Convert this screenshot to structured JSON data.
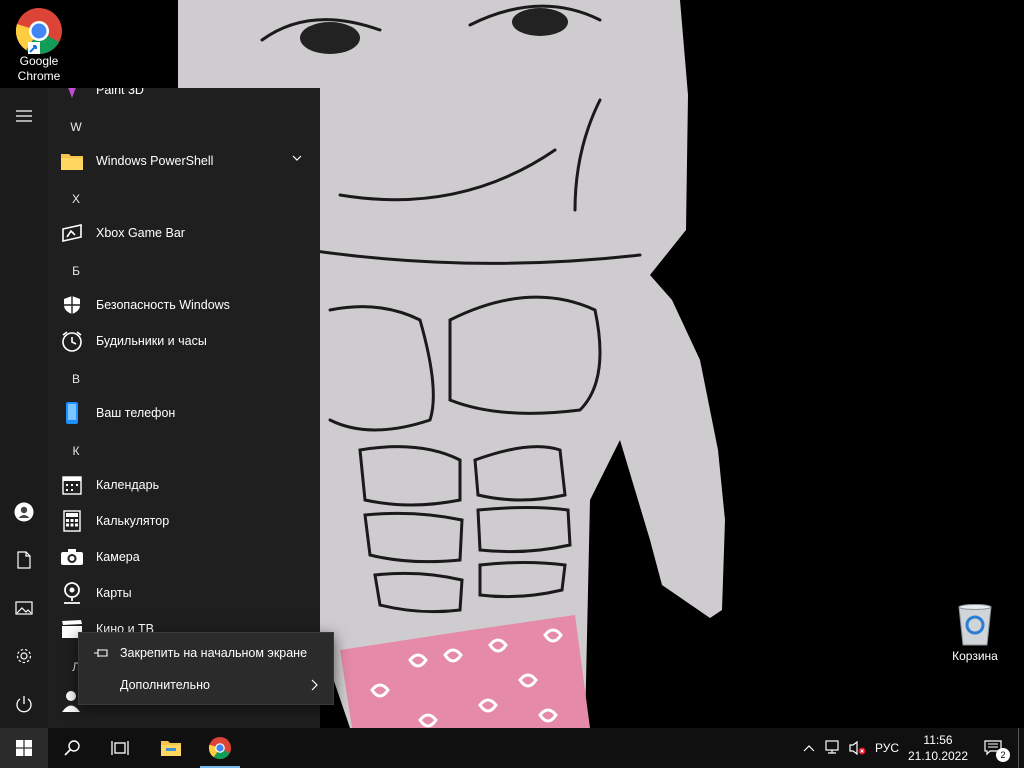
{
  "desktop": {
    "icons": [
      {
        "label_line1": "Google",
        "label_line2": "Chrome",
        "icon": "chrome-icon"
      },
      {
        "label": "Корзина",
        "icon": "recycle-bin-icon"
      }
    ]
  },
  "start_menu": {
    "partial_top_item": "Paint 3D",
    "groups": [
      {
        "letter": "W",
        "items": [
          {
            "label": "Windows PowerShell",
            "icon": "folder-icon",
            "expandable": true
          }
        ]
      },
      {
        "letter": "X",
        "items": [
          {
            "label": "Xbox Game Bar",
            "icon": "xbox-game-bar-icon"
          }
        ]
      },
      {
        "letter": "Б",
        "items": [
          {
            "label": "Безопасность Windows",
            "icon": "shield-icon"
          },
          {
            "label": "Будильники и часы",
            "icon": "alarm-clock-icon"
          }
        ]
      },
      {
        "letter": "В",
        "items": [
          {
            "label": "Ваш телефон",
            "icon": "phone-icon"
          }
        ]
      },
      {
        "letter": "К",
        "items": [
          {
            "label": "Календарь",
            "icon": "calendar-icon"
          },
          {
            "label": "Калькулятор",
            "icon": "calculator-icon"
          },
          {
            "label": "Камера",
            "icon": "camera-icon"
          },
          {
            "label": "Карты",
            "icon": "maps-icon"
          },
          {
            "label": "Кино и ТВ",
            "icon": "movies-icon"
          }
        ]
      },
      {
        "letter": "Л",
        "items": [
          {
            "label": "Л",
            "icon": "people-icon"
          }
        ]
      }
    ]
  },
  "context_menu": {
    "pin_label": "Закрепить на начальном экране",
    "more_label": "Дополнительно"
  },
  "taskbar": {
    "language": "РУС",
    "time": "11:56",
    "date": "21.10.2022",
    "notification_count": "2"
  }
}
